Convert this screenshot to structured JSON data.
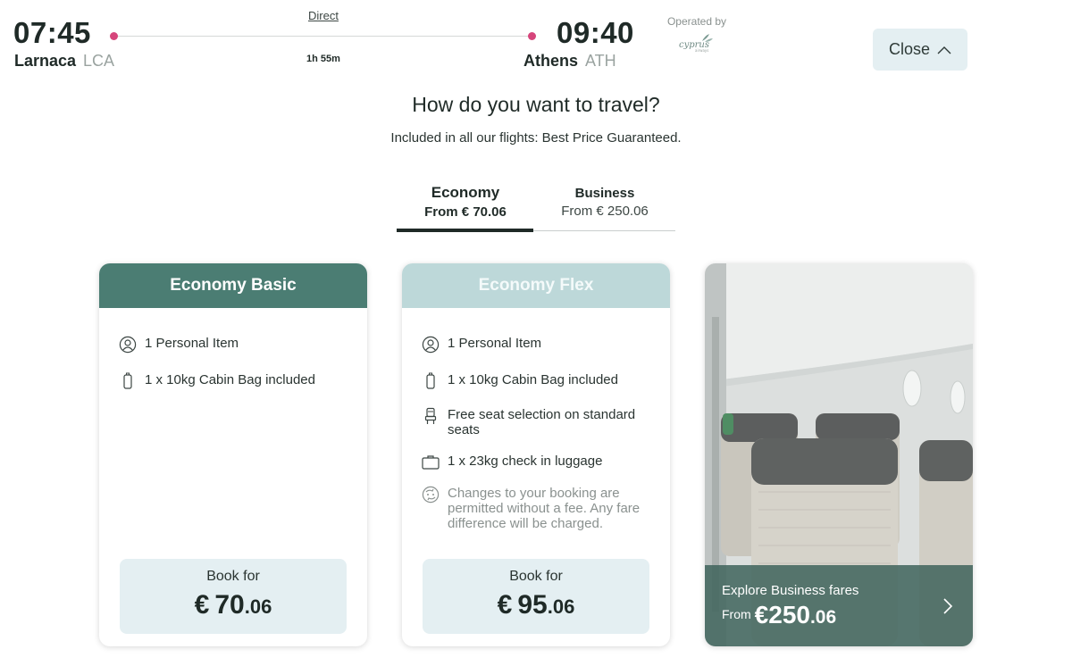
{
  "flight": {
    "departure": {
      "time": "07:45",
      "city": "Larnaca",
      "code": "LCA"
    },
    "arrival": {
      "time": "09:40",
      "city": "Athens",
      "code": "ATH"
    },
    "stops": "Direct",
    "duration": "1h 55m",
    "operated_by_label": "Operated by",
    "operator_logo": "cyprus-airways-logo"
  },
  "close_button": {
    "label": "Close",
    "icon": "chevron-up-icon"
  },
  "heading": "How do you want to travel?",
  "subheading": "Included in all our flights: Best Price Guaranteed.",
  "tabs": [
    {
      "name": "Economy",
      "price": "From € 70.06",
      "active": true
    },
    {
      "name": "Business",
      "price": "From € 250.06",
      "active": false
    }
  ],
  "fares": [
    {
      "title": "Economy Basic",
      "color": "#4b7d73",
      "features": [
        {
          "icon": "person-icon",
          "text": "1 Personal Item"
        },
        {
          "icon": "cabin-bag-icon",
          "text": "1 x 10kg Cabin Bag included"
        }
      ],
      "book_label": "Book for",
      "currency": "€",
      "price_int": "70",
      "price_dec": ".06"
    },
    {
      "title": "Economy Flex",
      "color": "#bdd8d9",
      "features": [
        {
          "icon": "person-icon",
          "text": "1 Personal Item"
        },
        {
          "icon": "cabin-bag-icon",
          "text": "1 x 10kg Cabin Bag included"
        },
        {
          "icon": "seat-icon",
          "text": "Free seat selection on standard seats"
        },
        {
          "icon": "suitcase-icon",
          "text": "1 x 23kg check in luggage"
        },
        {
          "icon": "change-booking-icon",
          "text": "Changes to your booking are permitted without a fee. Any fare difference will be charged."
        }
      ],
      "book_label": "Book for",
      "currency": "€",
      "price_int": "95",
      "price_dec": ".06"
    }
  ],
  "business_promo": {
    "title": "Explore Business fares",
    "from_label": "From",
    "currency": "€",
    "price_int": "250",
    "price_dec": ".06",
    "image": "business-cabin-seats-photo"
  },
  "colors": {
    "accent_dark": "#4b7d73",
    "accent_light": "#bdd8d9",
    "route_dot": "#d6457b",
    "pale_blue": "#e4eff2"
  }
}
